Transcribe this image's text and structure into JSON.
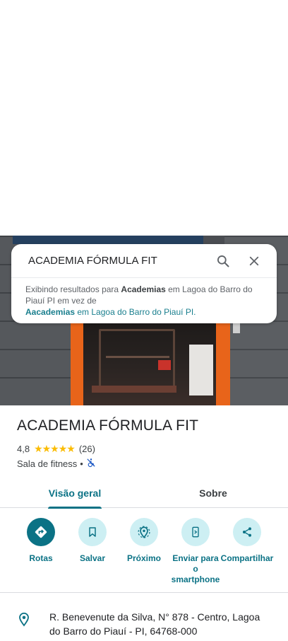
{
  "search": {
    "query": "ACADEMIA FÓRMULA FIT",
    "suggest_prefix": "Exibindo resultados para ",
    "suggest_bold": "Academias",
    "suggest_mid": " em Lagoa do Barro do Piauí PI em vez de",
    "suggest_link_bold": "Aacademias",
    "suggest_link_rest": " em Lagoa do Barro do Piauí PI."
  },
  "place": {
    "title": "ACADEMIA FÓRMULA FIT",
    "rating": "4,8",
    "stars": "★★★★★",
    "review_count": "(26)",
    "category": "Sala de fitness",
    "separator": "•"
  },
  "tabs": [
    {
      "label": "Visão geral",
      "active": true
    },
    {
      "label": "Sobre",
      "active": false
    }
  ],
  "actions": [
    {
      "label": "Rotas",
      "icon": "directions-icon"
    },
    {
      "label": "Salvar",
      "icon": "bookmark-icon"
    },
    {
      "label": "Próximo",
      "icon": "nearby-icon"
    },
    {
      "label": "Enviar para o smartphone",
      "icon": "send-to-phone-icon"
    },
    {
      "label": "Compartilhar",
      "icon": "share-icon"
    }
  ],
  "address": {
    "text": "R. Benevenute da Silva, N° 878 - Centro, Lagoa do Barro do Piauí - PI, 64768-000"
  },
  "colors": {
    "accent": "#0b7285",
    "action_bg": "#cdeff3",
    "star": "#fbbc04"
  }
}
